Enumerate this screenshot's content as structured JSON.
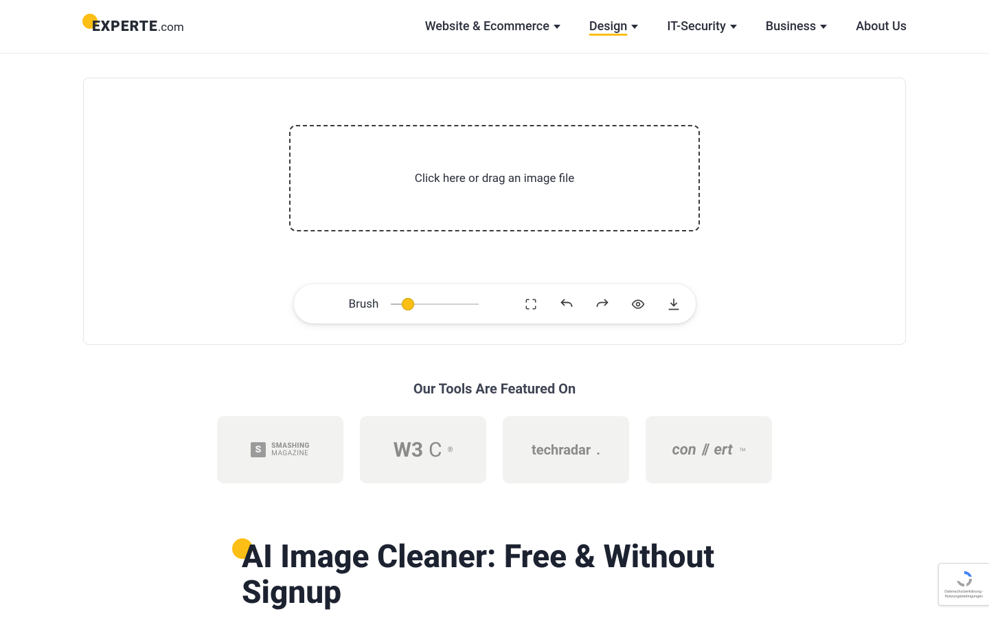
{
  "logo": {
    "main": "EXPERTE",
    "suffix": ".com"
  },
  "nav": {
    "items": [
      {
        "label": "Website & Ecommerce",
        "hasDropdown": true
      },
      {
        "label": "Design",
        "hasDropdown": true,
        "active": true
      },
      {
        "label": "IT-Security",
        "hasDropdown": true
      },
      {
        "label": "Business",
        "hasDropdown": true
      },
      {
        "label": "About Us",
        "hasDropdown": false
      }
    ]
  },
  "tool": {
    "dropzoneText": "Click here or drag an image file",
    "toolbar": {
      "brushLabel": "Brush"
    }
  },
  "featured": {
    "title": "Our Tools Are Featured On",
    "partners": {
      "smashing_line1": "SMASHING",
      "smashing_line2": "MAGAZINE",
      "w3c": "W3C",
      "techradar": "techradar",
      "convert": "convert",
      "convert_tm": "TM"
    }
  },
  "heading": "AI Image Cleaner: Free & Without Signup",
  "recaptcha": {
    "line1": "Datenschutzerklärung",
    "sep": " - ",
    "line2": "Nutzungsbedingungen"
  }
}
